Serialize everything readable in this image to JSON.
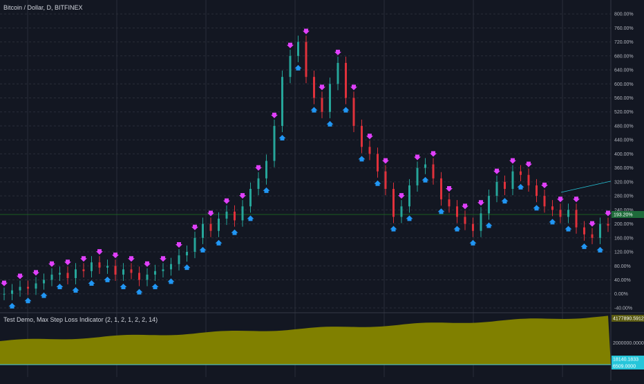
{
  "header": {
    "symbol_title": "Bitcoin / Dollar, D, BITFINEX"
  },
  "indicator": {
    "title": "Test Demo, Max Step Loss Indicator (2, 1, 2, 1, 2, 2, 14)",
    "scale_label": "2000000.0000",
    "badges": [
      "4177890.5912",
      "18140.1833",
      "6509.0000"
    ]
  },
  "price_badge": "193.20%",
  "colors": {
    "background": "#131722",
    "grid": "#2a2e39",
    "candle_up": "#26a69a",
    "candle_down": "#e0313b",
    "sell_marker": "#e040fb",
    "buy_marker": "#2196f3",
    "indicator_fill": "#808000",
    "price_tag": "#1e6b3a",
    "cyan_badge": "#26c6da",
    "trend_line": "#26c6da"
  },
  "chart_data": {
    "type": "candlestick",
    "title": "Bitcoin / Dollar, D, BITFINEX",
    "y_axis_unit": "%",
    "ylim": [
      -50,
      820
    ],
    "yticks": [
      "-40.00%",
      "0.00%",
      "40.00%",
      "80.00%",
      "120.00%",
      "160.00%",
      "200.00%",
      "240.00%",
      "280.00%",
      "320.00%",
      "360.00%",
      "400.00%",
      "440.00%",
      "480.00%",
      "520.00%",
      "560.00%",
      "600.00%",
      "640.00%",
      "680.00%",
      "720.00%",
      "760.00%",
      "800.00%"
    ],
    "grid": true,
    "current_value_pct": 193.2,
    "series": [
      {
        "name": "price",
        "values": [
          0,
          10,
          20,
          15,
          30,
          40,
          55,
          60,
          45,
          70,
          65,
          90,
          75,
          80,
          55,
          70,
          60,
          40,
          55,
          65,
          70,
          85,
          110,
          120,
          160,
          200,
          180,
          215,
          235,
          210,
          250,
          300,
          330,
          380,
          480,
          620,
          680,
          720,
          620,
          560,
          520,
          600,
          660,
          560,
          480,
          420,
          400,
          350,
          300,
          220,
          250,
          310,
          360,
          370,
          330,
          270,
          250,
          220,
          200,
          180,
          230,
          280,
          320,
          300,
          350,
          340,
          310,
          280,
          250,
          240,
          220,
          240,
          190,
          170,
          160,
          200,
          195
        ]
      }
    ]
  }
}
